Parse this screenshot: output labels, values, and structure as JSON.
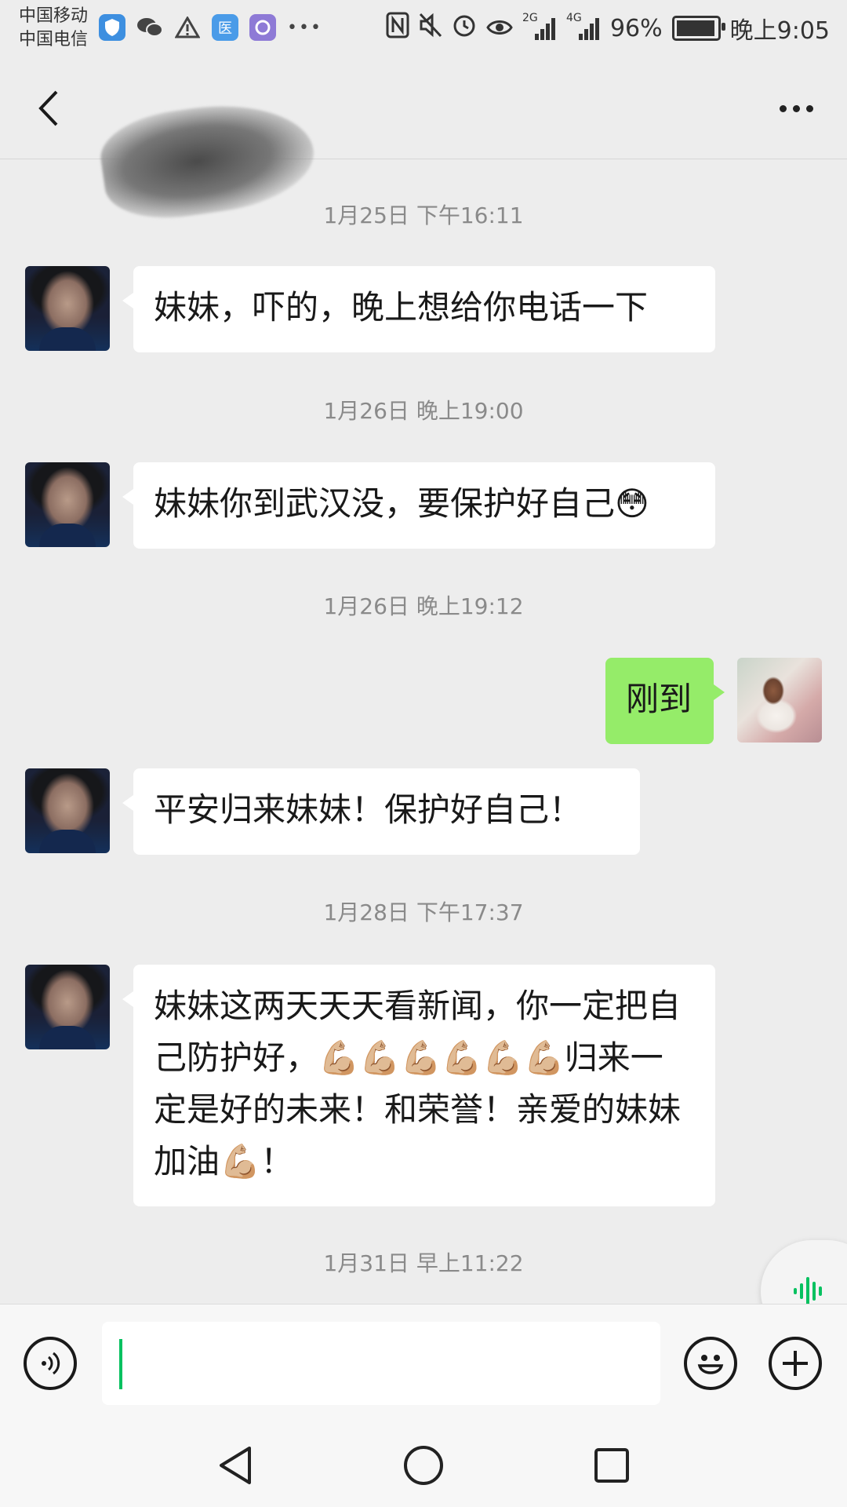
{
  "status_bar": {
    "carrier1": "中国移动",
    "carrier2": "中国电信",
    "left_icons": [
      "shield-icon",
      "wechat-icon",
      "warning-icon",
      "hospital-app-icon",
      "browser-app-icon",
      "more-dots-icon"
    ],
    "right_icons": [
      "nfc-icon",
      "mute-icon",
      "alarm-icon",
      "eye-icon",
      "signal-2g-icon",
      "signal-4g-icon"
    ],
    "signal1_label": "2G",
    "signal2_label": "4G",
    "battery_percent": "96%",
    "battery_level": 0.96,
    "time": "晚上9:05"
  },
  "header": {
    "back_icon": "chevron-left-icon",
    "title": "",
    "menu_icon": "more-icon"
  },
  "messages": [
    {
      "type": "timestamp",
      "text": "1月25日 下午16:11"
    },
    {
      "type": "bubble",
      "side": "left",
      "text": "妹妹，吓的，晚上想给你电话一下"
    },
    {
      "type": "timestamp",
      "text": "1月26日 晚上19:00"
    },
    {
      "type": "bubble",
      "side": "left",
      "text": "妹妹你到武汉没，要保护好自己😳"
    },
    {
      "type": "timestamp",
      "text": "1月26日 晚上19:12"
    },
    {
      "type": "bubble",
      "side": "right",
      "text": "刚到"
    },
    {
      "type": "bubble",
      "side": "left",
      "text": "平安归来妹妹！保护好自己！"
    },
    {
      "type": "timestamp",
      "text": "1月28日 下午17:37"
    },
    {
      "type": "bubble",
      "side": "left",
      "text": "妹妹这两天天天看新闻，你一定把自己防护好，💪🏼💪🏼💪🏼💪🏼💪🏼💪🏼归来一定是好的未来！和荣誉！亲爱的妹妹加油💪🏼！"
    },
    {
      "type": "timestamp",
      "text": "1月31日 早上11:22"
    }
  ],
  "input_bar": {
    "voice_icon": "voice-input-icon",
    "text_value": "",
    "emoji_icon": "emoji-icon",
    "plus_icon": "plus-icon",
    "voice_fab_icon": "voice-wave-icon"
  },
  "nav_bar": {
    "back_icon": "nav-back-icon",
    "home_icon": "nav-home-icon",
    "recents_icon": "nav-recents-icon"
  },
  "colors": {
    "background": "#ededed",
    "bubble_self": "#95ec69",
    "bubble_other": "#ffffff",
    "accent": "#07c160"
  }
}
